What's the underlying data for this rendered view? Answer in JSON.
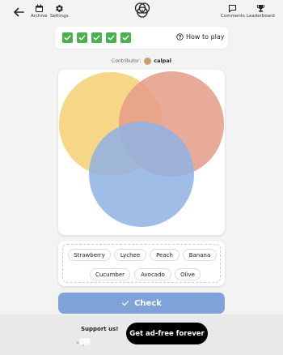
{
  "nav": {
    "archive_label": "Archive",
    "settings_label": "Settings",
    "comments_label": "Comments",
    "leaderboard_label": "Leaderboard"
  },
  "progress": {
    "checkbox_states": [
      true,
      true,
      true,
      true,
      true
    ],
    "howto_label": "How to play"
  },
  "contributor": {
    "label": "Contributor:",
    "name": "calpal"
  },
  "venn": {
    "circle_colors": [
      "#f5cf72",
      "#e59c87",
      "#8fb1e3"
    ]
  },
  "words": [
    "Strawberry",
    "Lychee",
    "Peach",
    "Banana",
    "Cucumber",
    "Avocado",
    "Olive"
  ],
  "check_button": {
    "label": "Check"
  },
  "footer": {
    "support_label": "Support us!",
    "adfree_label": "Get ad-free forever"
  },
  "colors": {
    "checkbox": "#4caf50",
    "check_button": "#7fa2d8",
    "background": "#f3f3f3"
  }
}
